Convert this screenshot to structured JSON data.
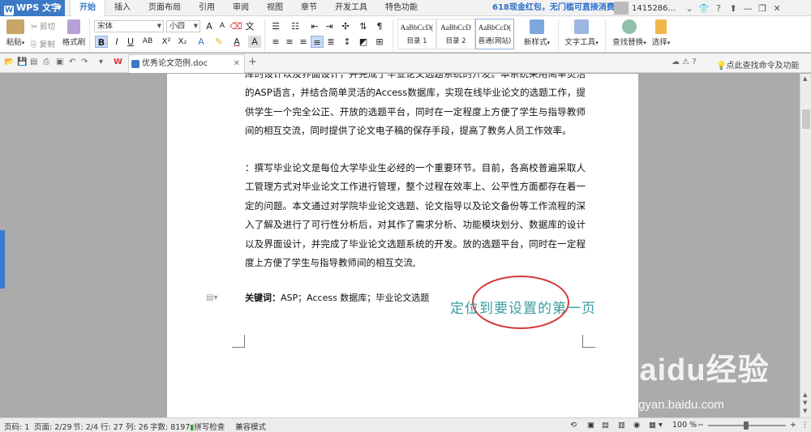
{
  "app": {
    "name": "WPS 文字"
  },
  "menu_tabs": [
    "开始",
    "插入",
    "页面布局",
    "引用",
    "审阅",
    "视图",
    "章节",
    "开发工具",
    "特色功能"
  ],
  "promo": "618现金红包，无门槛可直接消费",
  "user": {
    "name": "1415286..."
  },
  "ribbon": {
    "paste": "粘贴",
    "cut": "剪切",
    "copy": "复制",
    "format_painter": "格式刷",
    "font_name": "宋体",
    "font_size": "小四",
    "styles": [
      {
        "preview": "AaBbCcD(",
        "name": "目录 1"
      },
      {
        "preview": "AaBbCcD",
        "name": "目录 2"
      },
      {
        "preview": "AaBbCcD(",
        "name": "普通(网站)"
      }
    ],
    "new_style": "新样式",
    "text_tools": "文字工具",
    "find_replace": "查找替换",
    "select": "选择"
  },
  "doc_tab": {
    "title": "优秀论文范例.doc"
  },
  "search_hint": "点此查找命令及功能",
  "document": {
    "para1": "库的设计以及界面设计，并完成了毕业论文选题系统的开发。本系统采用简单灵活的ASP语言，并结合简单灵活的Access数据库，实现在线毕业论文的选题工作，提供学生一个完全公正、开放的选题平台，同时在一定程度上方便了学生与指导教师间的相互交流，同时提供了论文电子稿的保存手段，提高了教务人员工作效率。",
    "para2": "：撰写毕业论文是每位大学毕业生必经的一个重要环节。目前，各高校普遍采取人工管理方式对毕业论文工作进行管理，整个过程在效率上、公平性方面都存在着一定的问题。本文通过对学院毕业论文选题、论文指导以及论文备份等工作流程的深入了解及进行了可行性分析后，对其作了需求分析、功能模块划分、数据库的设计以及界面设计，并完成了毕业论文选题系统的开发。放的选题平台，同时在一定程度上方便了学生与指导教师间的相互交流,",
    "keywords_label": "关键词：",
    "keywords": "ASP；Access 数据库；毕业论文选题"
  },
  "annotation": "定位到要设置的第一页",
  "watermark": {
    "brand": "Baidu经验",
    "url": "jingyan.baidu.com"
  },
  "status": {
    "page_code": "页码: 1",
    "page": "页面: 2/29",
    "section": "节: 2/4",
    "row": "行: 27",
    "col": "列: 26",
    "words": "字数: 8197",
    "spell": "拼写检查",
    "compat": "兼容模式",
    "zoom": "100 %"
  },
  "colors": {
    "accent": "#3b79c4",
    "annotation": "#3a9ea0",
    "circle": "#d23a3a"
  }
}
